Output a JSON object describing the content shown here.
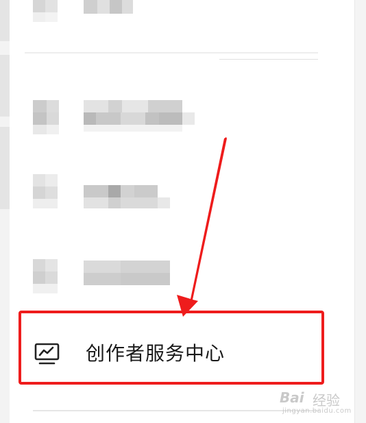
{
  "menu": {
    "creator_center_label": "创作者服务中心",
    "creator_center_icon": "chart-monitor-icon"
  },
  "watermark": {
    "brand": "Bai",
    "brand_cn": "经验",
    "url": "jingyan.baidu.com"
  },
  "colors": {
    "highlight": "#ee1c1c",
    "arrow": "#ee1c1c",
    "label": "#1a1a1a"
  }
}
